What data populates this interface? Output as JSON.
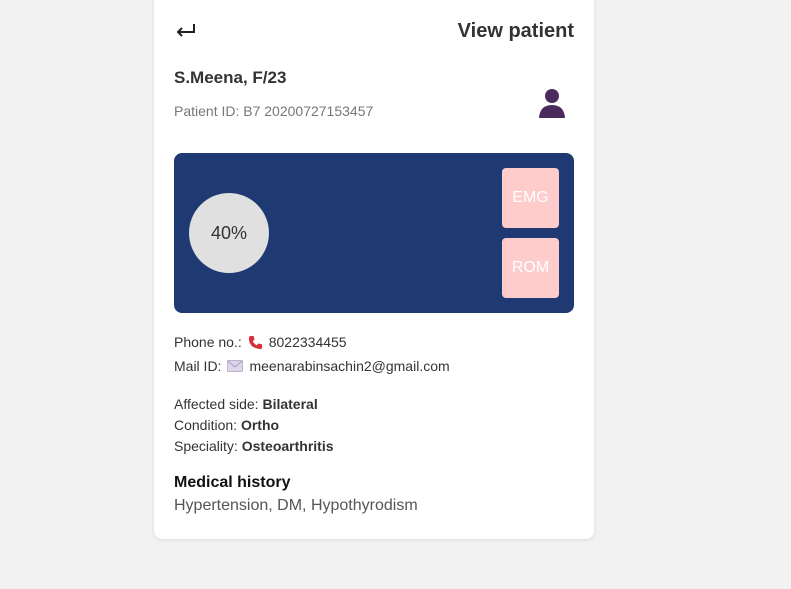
{
  "header": {
    "back_icon": "return-arrow-icon",
    "title": "View patient"
  },
  "patient": {
    "name": "S.Meena, F/23",
    "id_label": "Patient ID: B7 20200727153457",
    "avatar_icon": "user-avatar-icon",
    "avatar_color": "#4b2a5c"
  },
  "panel": {
    "background": "#1f3a72",
    "progress_text": "40%",
    "progress_value": 0.4,
    "buttons": {
      "emg": "EMG",
      "rom": "ROM"
    },
    "button_color": "#ffcccc"
  },
  "contact": {
    "phone_label": "Phone no.:",
    "phone_icon": "phone-icon",
    "phone": "8022334455",
    "mail_label": "Mail ID:",
    "mail_icon": "envelope-icon",
    "email": "meenarabinsachin2@gmail.com"
  },
  "details": {
    "affected_side_label": "Affected side:",
    "affected_side": "Bilateral",
    "condition_label": "Condition:",
    "condition": "Ortho",
    "speciality_label": "Speciality:",
    "speciality": "Osteoarthritis"
  },
  "history": {
    "title": "Medical history",
    "text": "Hypertension, DM, Hypothyrodism"
  }
}
